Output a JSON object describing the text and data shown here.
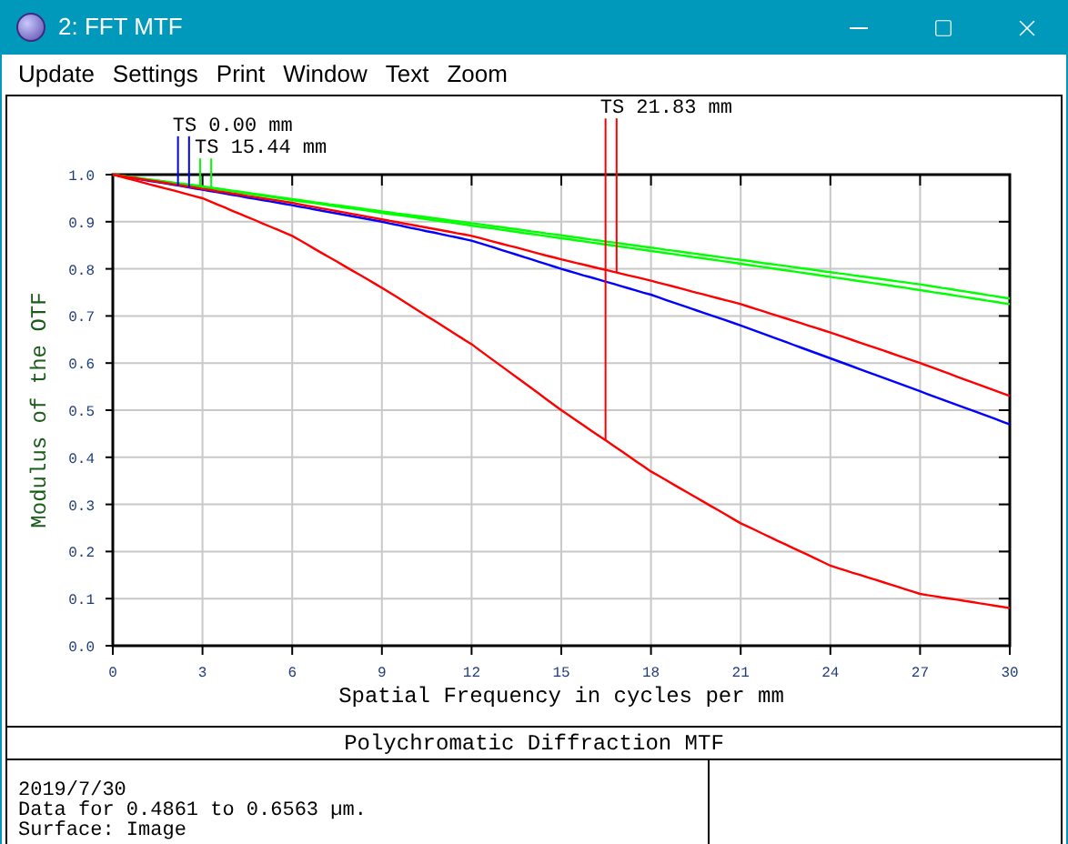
{
  "window": {
    "title": "2: FFT MTF"
  },
  "menu": [
    "Update",
    "Settings",
    "Print",
    "Window",
    "Text",
    "Zoom"
  ],
  "plot": {
    "chart_data": {
      "type": "line",
      "xlabel": "Spatial Frequency in cycles per mm",
      "ylabel": "Modulus of the OTF",
      "x": [
        0,
        3,
        6,
        9,
        12,
        15,
        18,
        21,
        24,
        27,
        30
      ],
      "series": [
        {
          "color": "#0000ff",
          "values": [
            1,
            0.968,
            0.935,
            0.9,
            0.86,
            0.8,
            0.745,
            0.68,
            0.61,
            0.54,
            0.47
          ]
        },
        {
          "color": "#00ff00",
          "values": [
            1,
            0.975,
            0.948,
            0.922,
            0.897,
            0.871,
            0.845,
            0.819,
            0.793,
            0.767,
            0.737
          ]
        },
        {
          "color": "#00ff00",
          "values": [
            1,
            0.974,
            0.946,
            0.919,
            0.892,
            0.865,
            0.838,
            0.811,
            0.783,
            0.755,
            0.725
          ]
        },
        {
          "color": "#ff0000",
          "values": [
            1,
            0.95,
            0.87,
            0.76,
            0.64,
            0.5,
            0.37,
            0.26,
            0.17,
            0.11,
            0.08
          ]
        },
        {
          "color": "#ff0000",
          "values": [
            1,
            0.97,
            0.94,
            0.905,
            0.87,
            0.82,
            0.775,
            0.725,
            0.665,
            0.6,
            0.53
          ]
        }
      ],
      "xlim": [
        0,
        30
      ],
      "ylim": [
        0,
        1
      ],
      "grid": true,
      "xticks": [
        0,
        3,
        6,
        9,
        12,
        15,
        18,
        21,
        24,
        27,
        30
      ],
      "yticks": [
        {
          "value": 0,
          "label": "0.0"
        },
        {
          "value": 0.1,
          "label": "0.1"
        },
        {
          "value": 0.2,
          "label": "0.2"
        },
        {
          "value": 0.3,
          "label": "0.3"
        },
        {
          "value": 0.4,
          "label": "0.4"
        },
        {
          "value": 0.5,
          "label": "0.5"
        },
        {
          "value": 0.6,
          "label": "0.6"
        },
        {
          "value": 0.7,
          "label": "0.7"
        },
        {
          "value": 0.8,
          "label": "0.8"
        },
        {
          "value": 0.9,
          "label": "0.9"
        },
        {
          "value": 1,
          "label": "1.0"
        }
      ],
      "annotations": [
        "TS 0.00 mm",
        "TS 15.44 mm",
        "TS 21.83 mm"
      ]
    }
  },
  "footer": {
    "title": "Polychromatic Diffraction MTF",
    "lines": [
      "2019/7/30",
      "Data for 0.4861 to 0.6563 µm.",
      "Surface: Image"
    ]
  }
}
